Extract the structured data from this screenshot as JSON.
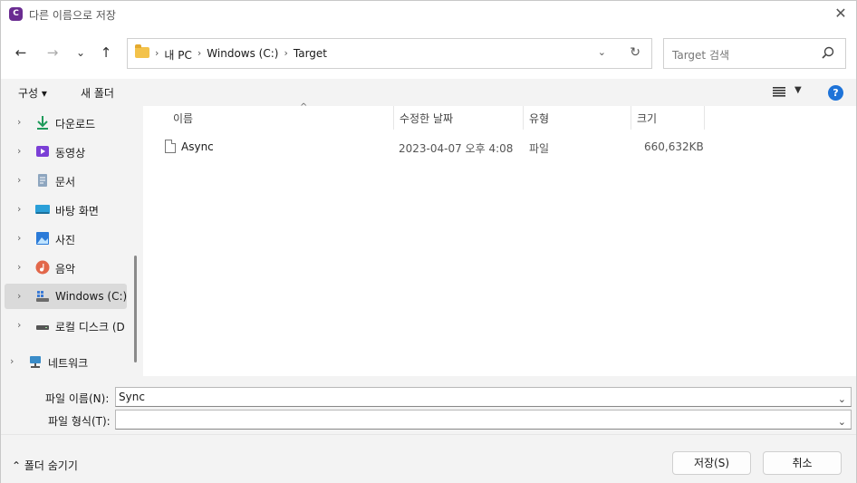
{
  "window": {
    "title": "다른 이름으로 저장",
    "app_icon_letter": "C",
    "close_glyph": "✕"
  },
  "nav": {
    "back_glyph": "←",
    "forward_glyph": "→",
    "recent_glyph": "⌄",
    "up_glyph": "↑",
    "breadcrumb": [
      "내 PC",
      "Windows (C:)",
      "Target"
    ],
    "separator": "›",
    "dropdown_glyph": "⌄",
    "refresh_glyph": "↻",
    "search_placeholder": "Target 검색"
  },
  "commandbar": {
    "organize": "구성 ▾",
    "new_folder": "새 폴더",
    "view_dd_glyph": "▼",
    "help_glyph": "?"
  },
  "sidebar": {
    "items": [
      {
        "label": "다운로드",
        "icon": "download-icon",
        "color": "#1e9a5a"
      },
      {
        "label": "동영상",
        "icon": "video-icon",
        "color": "#7b3fd6"
      },
      {
        "label": "문서",
        "icon": "document-icon",
        "color": "#6f8fb0"
      },
      {
        "label": "바탕 화면",
        "icon": "desktop-icon",
        "color": "#2a9fd8"
      },
      {
        "label": "사진",
        "icon": "pictures-icon",
        "color": "#2a7ad8"
      },
      {
        "label": "음악",
        "icon": "music-icon",
        "color": "#e2674a"
      },
      {
        "label": "Windows (C:)",
        "icon": "drive-icon",
        "color": "#3b7bd6",
        "selected": true
      },
      {
        "label": "로컬 디스크 (D",
        "icon": "disk-icon",
        "color": "#555555"
      },
      {
        "label": "네트워크",
        "icon": "network-icon",
        "color": "#3a8cc8"
      }
    ],
    "chevron_glyph": "›"
  },
  "filelist": {
    "columns": [
      "이름",
      "수정한 날짜",
      "유형",
      "크기"
    ],
    "sort_glyph": "^",
    "rows": [
      {
        "name": "Async",
        "modified": "2023-04-07 오후 4:08",
        "type": "파일",
        "size": "660,632KB"
      }
    ]
  },
  "fields": {
    "filename_label": "파일 이름(N):",
    "filename_value": "Sync",
    "filetype_label": "파일 형식(T):",
    "filetype_value": "",
    "dd_glyph": "⌄"
  },
  "footer": {
    "hide_folders": "⌃ 폴더 숨기기",
    "save": "저장(S)",
    "cancel": "취소"
  }
}
